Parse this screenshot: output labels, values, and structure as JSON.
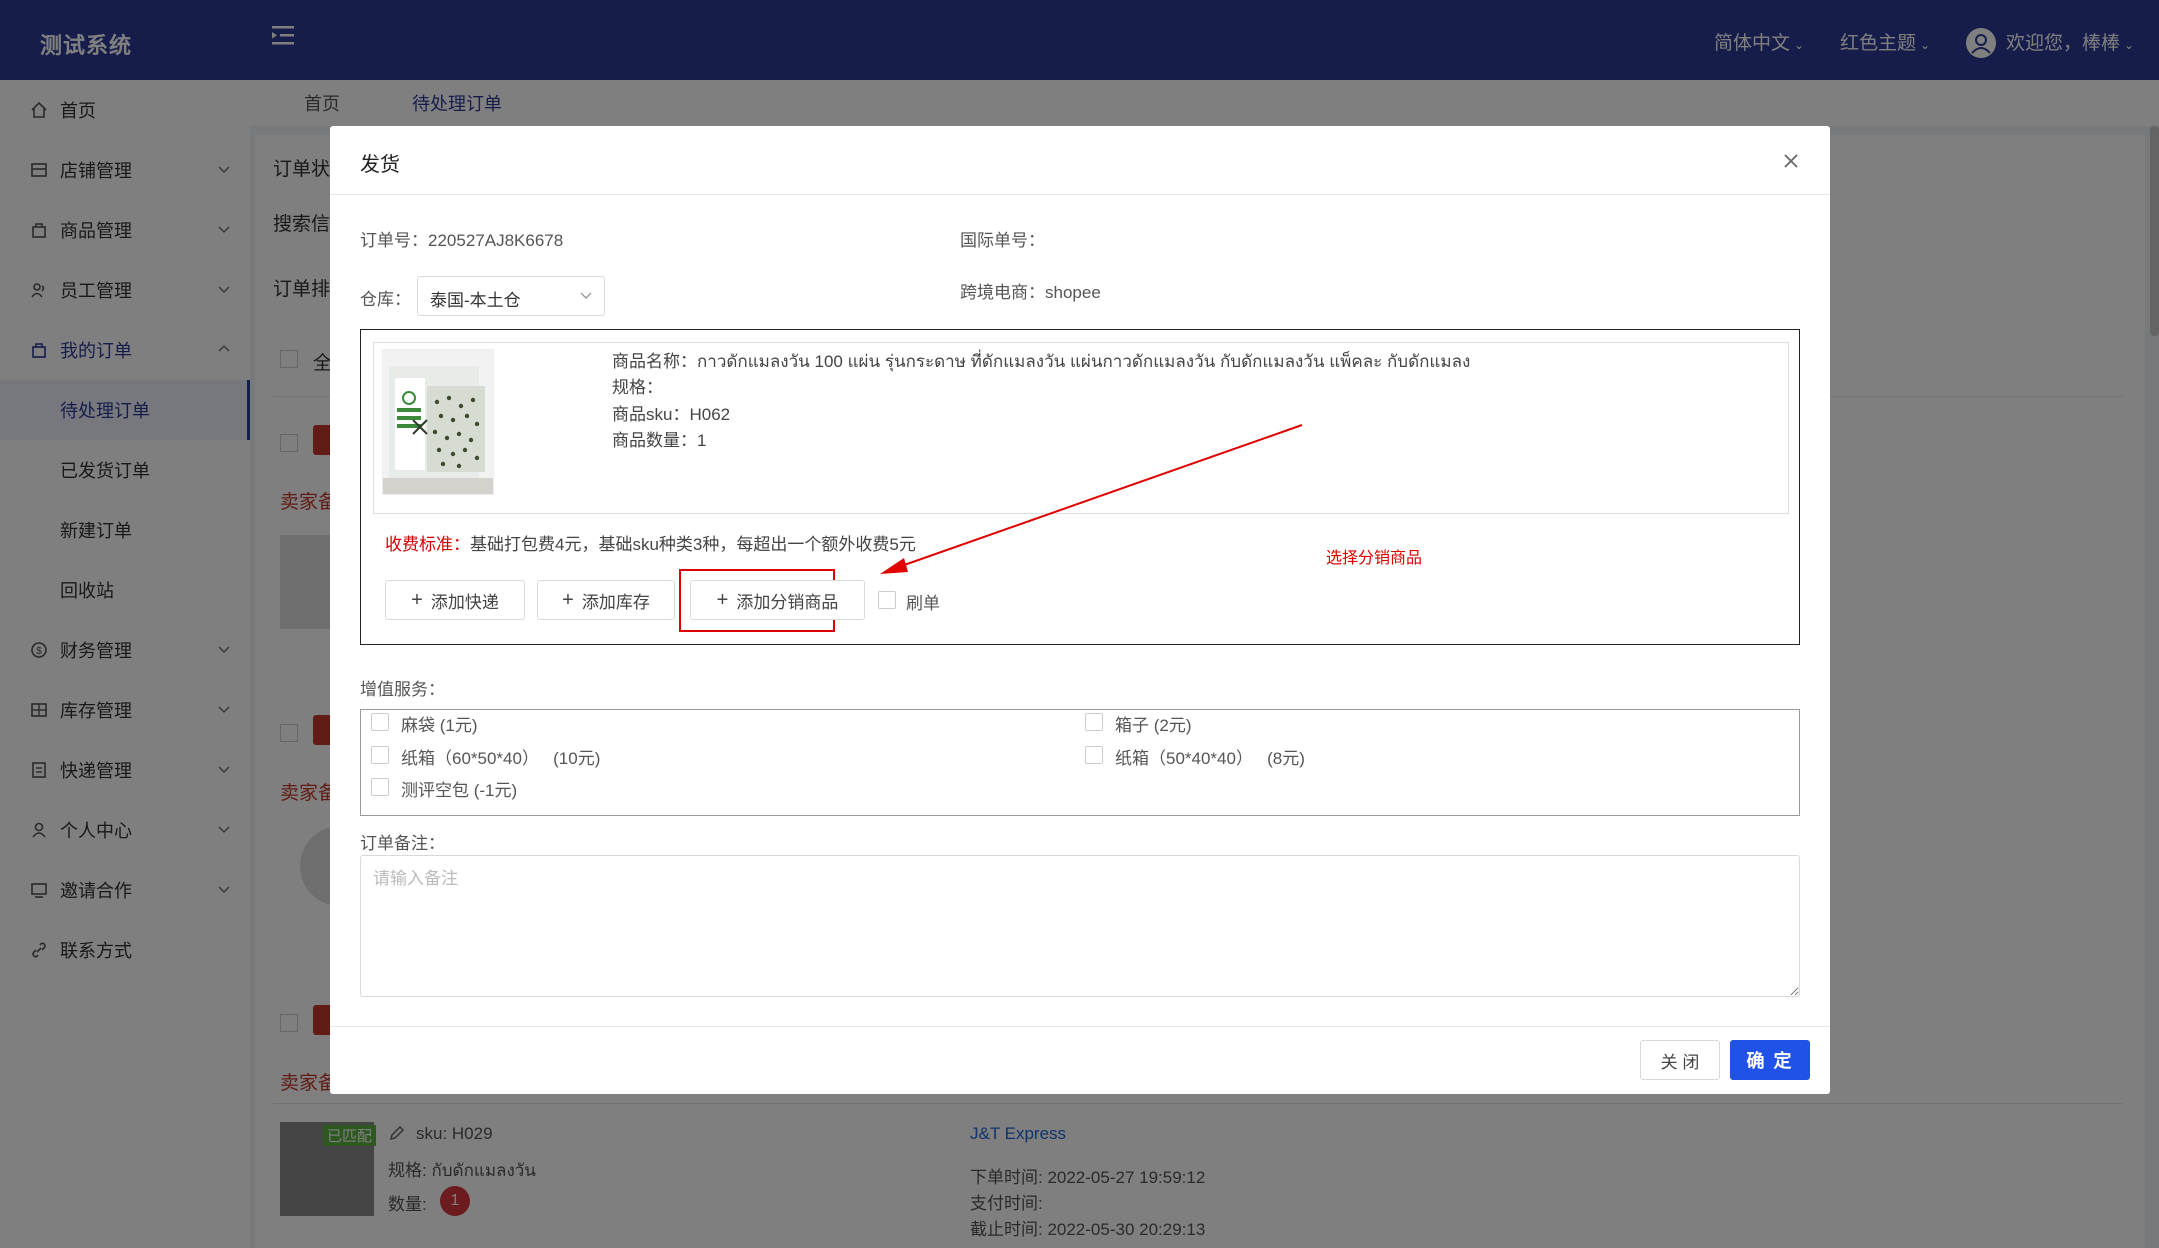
{
  "app": {
    "title": "测试系统"
  },
  "header": {
    "language": "简体中文",
    "theme": "红色主题",
    "welcome": "欢迎您，棒棒"
  },
  "sidebar": {
    "items": [
      {
        "label": "首页",
        "icon": "home-icon"
      },
      {
        "label": "店铺管理",
        "icon": "store-icon"
      },
      {
        "label": "商品管理",
        "icon": "bag-icon"
      },
      {
        "label": "员工管理",
        "icon": "team-icon"
      },
      {
        "label": "我的订单",
        "icon": "order-icon"
      },
      {
        "label": "财务管理",
        "icon": "finance-icon"
      },
      {
        "label": "库存管理",
        "icon": "inventory-icon"
      },
      {
        "label": "快递管理",
        "icon": "express-icon"
      },
      {
        "label": "个人中心",
        "icon": "user-icon"
      },
      {
        "label": "邀请合作",
        "icon": "invite-icon"
      },
      {
        "label": "联系方式",
        "icon": "link-icon"
      }
    ],
    "sub_items": [
      "待处理订单",
      "已发货订单",
      "新建订单",
      "回收站"
    ]
  },
  "tabs": [
    "首页",
    "待处理订单"
  ],
  "background": {
    "labels": [
      "订单状",
      "搜索信",
      "订单排",
      "全"
    ],
    "seller_note": "卖家备",
    "row": {
      "badge": "已匹配",
      "sku": "sku: H029",
      "spec": "规格:  กับดักแมลงวัน",
      "qty_label": "数量:",
      "qty": "1",
      "carrier": "J&T Express",
      "order_time": "下单时间:  2022-05-27 19:59:12",
      "pay_time": "支付时间:",
      "deadline": "截止时间:  2022-05-30 20:29:13"
    }
  },
  "modal": {
    "title": "发货",
    "order_no_label": "订单号：",
    "order_no": "220527AJ8K6678",
    "intl_no_label": "国际单号：",
    "intl_no": "",
    "warehouse_label": "仓库：",
    "warehouse": "泰国-本土仓",
    "platform_label": "跨境电商：",
    "platform": "shopee",
    "goods": {
      "name_label": "商品名称：",
      "name": "กาวดักแมลงวัน 100 แผ่น รุ่นกระดาษ ที่ดักแมลงวัน แผ่นกาวดักแมลงวัน กับดักแมลงวัน แพ็คละ กับดักแมลง",
      "spec_label": "规格：",
      "spec": "",
      "sku_label": "商品sku：",
      "sku": "H062",
      "qty_label": "商品数量：",
      "qty": "1"
    },
    "fee_label": "收费标准：",
    "fee_text": "基础打包费4元，基础sku种类3种，每超出一个额外收费5元",
    "buttons": {
      "add_express": "添加快递",
      "add_stock": "添加库存",
      "add_distribution": "添加分销商品",
      "brush": "刷单"
    },
    "annotation": "选择分销商品",
    "vas_label": "增值服务：",
    "vas": [
      {
        "name": "麻袋",
        "price": "(1元)"
      },
      {
        "name": "箱子",
        "price": "(2元)"
      },
      {
        "name": "纸箱（60*50*40）",
        "price": "(10元)"
      },
      {
        "name": "纸箱（50*40*40）",
        "price": "(8元)"
      },
      {
        "name": "测评空包",
        "price": "(-1元)"
      }
    ],
    "remark_label": "订单备注：",
    "remark_placeholder": "请输入备注",
    "close": "关 闭",
    "confirm": "确 定"
  },
  "colors": {
    "header_bg": "#2d3b97",
    "primary": "#2152e8",
    "annotation": "#e00000"
  }
}
